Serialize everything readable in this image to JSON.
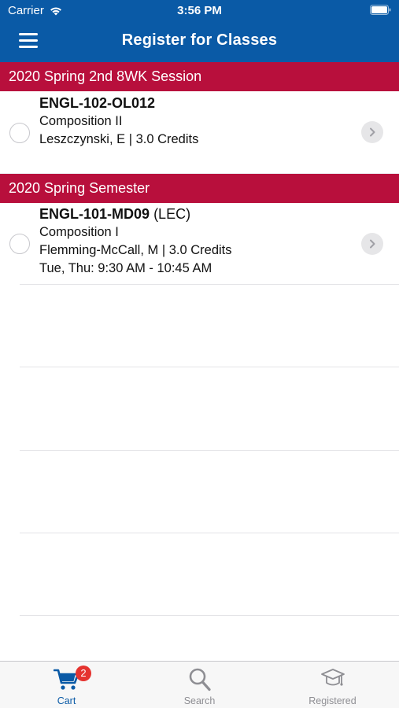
{
  "status_bar": {
    "carrier": "Carrier",
    "time": "3:56 PM"
  },
  "nav": {
    "title": "Register for Classes",
    "menu_icon": "hamburger-menu-icon"
  },
  "sections": [
    {
      "title": "2020 Spring 2nd 8WK Session",
      "classes": [
        {
          "code": "ENGL-102-OL012",
          "type": "",
          "name": "Composition II",
          "instructor_credits": "Leszczynski, E | 3.0 Credits",
          "schedule": ""
        }
      ]
    },
    {
      "title": "2020 Spring Semester",
      "classes": [
        {
          "code": "ENGL-101-MD09",
          "type": "(LEC)",
          "name": "Composition I",
          "instructor_credits": "Flemming-McCall, M | 3.0 Credits",
          "schedule": "Tue, Thu: 9:30 AM - 10:45 AM"
        }
      ]
    }
  ],
  "tabs": [
    {
      "label": "Cart",
      "icon": "cart-icon",
      "active": true,
      "badge": "2"
    },
    {
      "label": "Search",
      "icon": "search-icon",
      "active": false
    },
    {
      "label": "Registered",
      "icon": "graduation-cap-icon",
      "active": false
    }
  ],
  "colors": {
    "header_blue": "#0a5aa6",
    "section_red": "#b80f3c",
    "badge_red": "#e5332f",
    "inactive_gray": "#8e8e93"
  }
}
